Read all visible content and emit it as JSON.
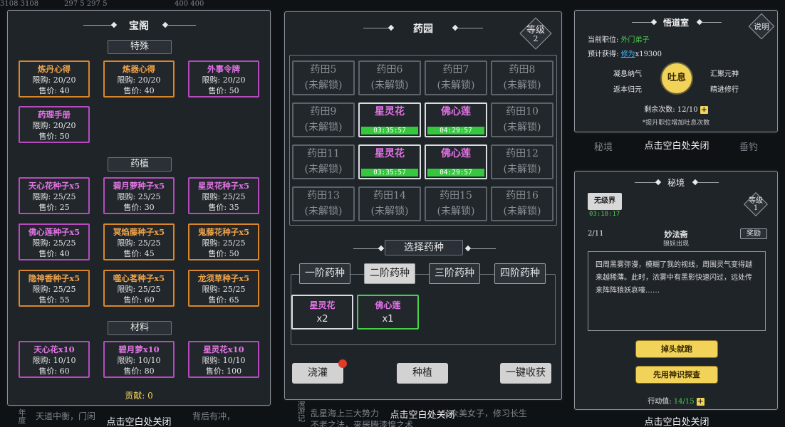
{
  "backdrop": {
    "top_left_text": "3108 3108",
    "top_left_text2": "297 5 297 5",
    "top_mid_text": "400 400",
    "bottom_left_text": "天道中衡，门闲",
    "bottom_left_text2": "背后有冲，",
    "bottom_mid_text": "乱星海上三大势力",
    "bottom_mid_text2": "公众美女子，修习长生",
    "bottom_mid_text3": "不老之法，来居腾漆惶之术",
    "bottom_right_tab1": "秘境",
    "bottom_right_tab2": "垂钓",
    "vertical_left": "年度",
    "vertical_mid": "漫游记"
  },
  "shop": {
    "title": "宝阁",
    "sections": [
      {
        "name": "特殊",
        "items": [
          {
            "name": "炼丹心得",
            "limit": "限购: 20/20",
            "price": "售价: 40",
            "color": "orange"
          },
          {
            "name": "炼器心得",
            "limit": "限购: 20/20",
            "price": "售价: 40",
            "color": "orange"
          },
          {
            "name": "外事令牌",
            "limit": "限购: 20/20",
            "price": "售价: 50",
            "color": "purple"
          },
          {
            "name": "药理手册",
            "limit": "限购: 20/20",
            "price": "售价: 50",
            "color": "purple"
          }
        ]
      },
      {
        "name": "药植",
        "items": [
          {
            "name": "天心花种子x5",
            "limit": "限购: 25/25",
            "price": "售价: 25",
            "color": "purple"
          },
          {
            "name": "碧月萝种子x5",
            "limit": "限购: 25/25",
            "price": "售价: 30",
            "color": "purple"
          },
          {
            "name": "星灵花种子x5",
            "limit": "限购: 25/25",
            "price": "售价: 35",
            "color": "purple"
          },
          {
            "name": "佛心莲种子x5",
            "limit": "限购: 25/25",
            "price": "售价: 40",
            "color": "purple"
          },
          {
            "name": "冥焰藤种子x5",
            "limit": "限购: 25/25",
            "price": "售价: 45",
            "color": "orange"
          },
          {
            "name": "鬼藤花种子x5",
            "limit": "限购: 25/25",
            "price": "售价: 50",
            "color": "orange"
          },
          {
            "name": "隐神香种子x5",
            "limit": "限购: 25/25",
            "price": "售价: 55",
            "color": "orange"
          },
          {
            "name": "噬心茗种子x5",
            "limit": "限购: 25/25",
            "price": "售价: 60",
            "color": "orange"
          },
          {
            "name": "龙须草种子x5",
            "limit": "限购: 25/25",
            "price": "售价: 65",
            "color": "orange"
          }
        ]
      },
      {
        "name": "材料",
        "items": [
          {
            "name": "天心花x10",
            "limit": "限购: 10/10",
            "price": "售价: 60",
            "color": "purple"
          },
          {
            "name": "碧月萝x10",
            "limit": "限购: 10/10",
            "price": "售价: 80",
            "color": "purple"
          },
          {
            "name": "星灵花x10",
            "limit": "限购: 10/10",
            "price": "售价: 100",
            "color": "purple"
          }
        ]
      }
    ],
    "contribution": "贡献: 0",
    "close_hint": "点击空白处关闭"
  },
  "garden": {
    "title": "药园",
    "level_label": "等级",
    "level_value": "2",
    "plots": [
      {
        "name": "药田5",
        "status": "(未解锁)",
        "active": false
      },
      {
        "name": "药田6",
        "status": "(未解锁)",
        "active": false
      },
      {
        "name": "药田7",
        "status": "(未解锁)",
        "active": false
      },
      {
        "name": "药田8",
        "status": "(未解锁)",
        "active": false
      },
      {
        "name": "药田9",
        "status": "(未解锁)",
        "active": false
      },
      {
        "name": "星灵花",
        "status": "03:35:57",
        "active": true
      },
      {
        "name": "佛心莲",
        "status": "04:29:57",
        "active": true
      },
      {
        "name": "药田10",
        "status": "(未解锁)",
        "active": false
      },
      {
        "name": "药田11",
        "status": "(未解锁)",
        "active": false
      },
      {
        "name": "星灵花",
        "status": "03:35:57",
        "active": true
      },
      {
        "name": "佛心莲",
        "status": "04:29:57",
        "active": true
      },
      {
        "name": "药田12",
        "status": "(未解锁)",
        "active": false
      },
      {
        "name": "药田13",
        "status": "(未解锁)",
        "active": false
      },
      {
        "name": "药田14",
        "status": "(未解锁)",
        "active": false
      },
      {
        "name": "药田15",
        "status": "(未解锁)",
        "active": false
      },
      {
        "name": "药田16",
        "status": "(未解锁)",
        "active": false
      }
    ],
    "select_title": "选择药种",
    "tabs": [
      "一阶药种",
      "二阶药种",
      "三阶药种",
      "四阶药种"
    ],
    "selected_tab": 1,
    "seeds": [
      {
        "name": "星灵花",
        "count": "x2"
      },
      {
        "name": "佛心莲",
        "count": "x1"
      }
    ],
    "water_label": "浇灌",
    "plant_label": "种植",
    "harvest_label": "一键收获",
    "close_hint": "点击空白处关闭"
  },
  "enlighten": {
    "title": "悟道室",
    "explain_label": "说明",
    "position_label": "当前职位:",
    "position_value": "外门弟子",
    "expect_label": "预计获得:",
    "expect_value": "修为",
    "expect_amount": "x19300",
    "opt1": "凝息纳气",
    "opt2": "汇聚元神",
    "opt3": "返本归元",
    "opt4": "精进修行",
    "center_label": "吐息",
    "remaining": "剩余次数: 12/10",
    "hint": "*提升职位增加吐息次数",
    "close_hint": "点击空白处关闭"
  },
  "realm": {
    "title": "秘境",
    "realm_name": "无级界",
    "realm_timer": "03:18:17",
    "level_label": "等级",
    "level_value": "1",
    "progress": "2/11",
    "place": "妙法斋",
    "event": "狼妖出现",
    "reward_label": "奖励",
    "story": "四周黑雾弥漫，模糊了我的视线，周围灵气变得越来越稀薄。此时，浓雾中有黑影快速闪过，远处传来阵阵狼妖哀嚎……",
    "choice1": "掉头就跑",
    "choice2": "先用神识探查",
    "action_label": "行动值:",
    "action_value": "14/15",
    "close_hint": "点击空白处关闭"
  },
  "colors": {
    "orange": "#d9862a",
    "purple": "#b64bbf",
    "green": "#36c73f",
    "yellow": "#f1d35a"
  }
}
